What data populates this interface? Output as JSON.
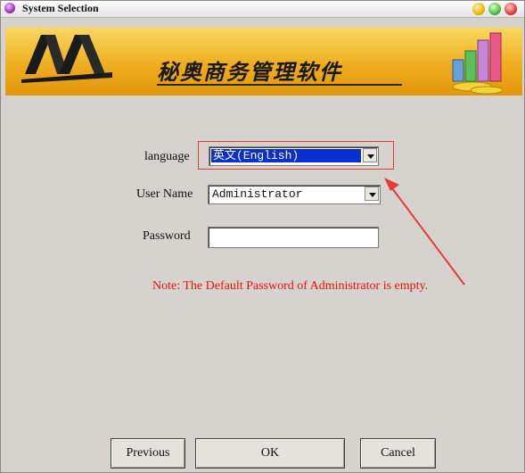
{
  "window": {
    "title": "System Selection"
  },
  "banner": {
    "title": "秘奥商务管理软件"
  },
  "form": {
    "language_label": "language",
    "language_value": "英文(English)",
    "username_label": "User Name",
    "username_value": "Administrator",
    "password_label": "Password",
    "password_value": ""
  },
  "note": "Note: The Default Password of Administrator is empty.",
  "buttons": {
    "previous": "Previous",
    "ok": "OK",
    "cancel": "Cancel"
  },
  "colors": {
    "accent_highlight": "#e53935",
    "selection": "#0a2fd0",
    "note_text": "#ee1111",
    "banner": "#efad1f"
  },
  "icons": [
    "app-icon",
    "minimize-icon",
    "maximize-icon",
    "close-icon",
    "dropdown-arrow-icon",
    "annotation-arrow"
  ]
}
